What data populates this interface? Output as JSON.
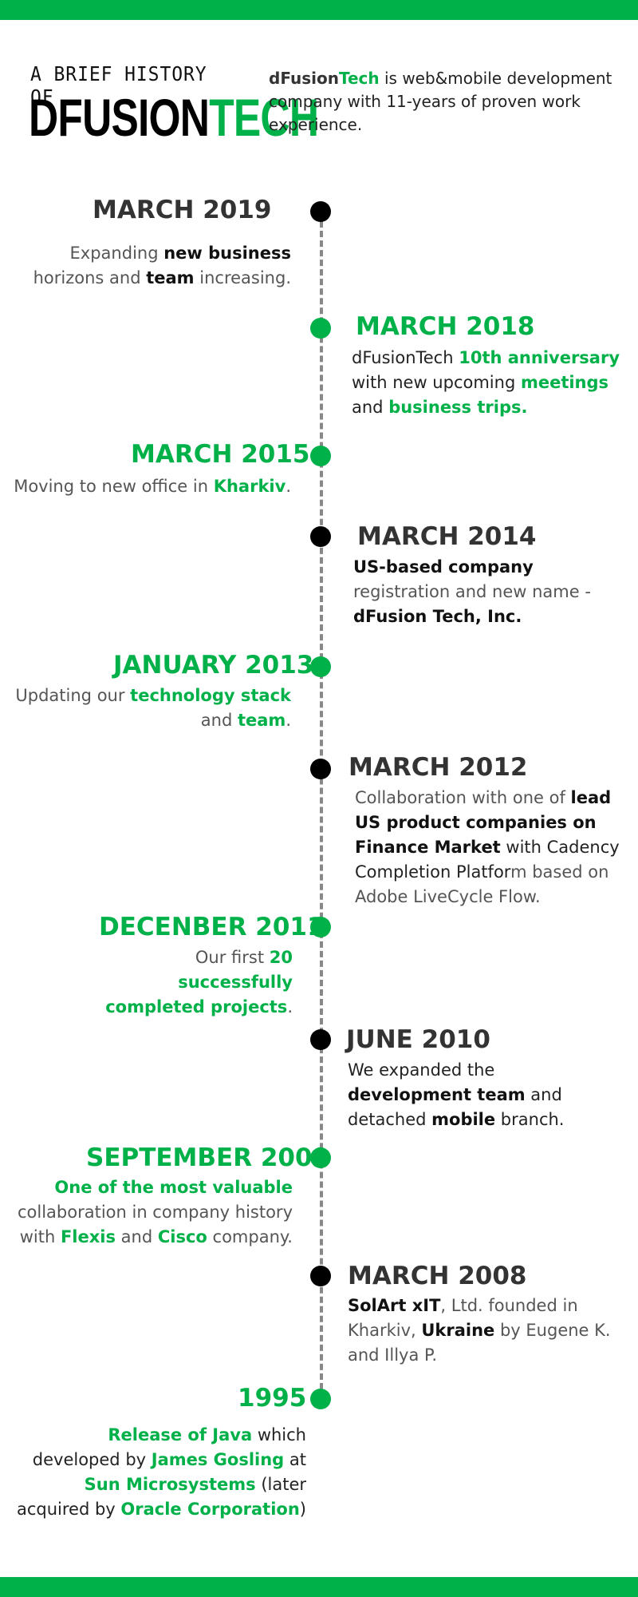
{
  "colors": {
    "accent": "#00b048",
    "dark": "#333333",
    "black": "#000000",
    "line": "#888888"
  },
  "header": {
    "pre": "A BRIEF HISTORY OF",
    "logo_part1": "DFUSION",
    "logo_part2": "TECH",
    "intro_name1": "dFusion",
    "intro_name2": "Tech",
    "intro_text": " is web&mobile development company with 11-years of proven work experience."
  },
  "events": [
    {
      "date": "MARCH 2019",
      "parts": [
        "Expanding ",
        "new business",
        " horizons and ",
        "team",
        " increasing."
      ]
    },
    {
      "date": "MARCH 2018",
      "parts": [
        "dFusionTech ",
        "10th anniversary",
        " with new upcoming ",
        "meetings",
        " and ",
        "business trips."
      ]
    },
    {
      "date": "MARCH 2015",
      "parts": [
        "Moving to new office in ",
        "Kharkiv",
        "."
      ]
    },
    {
      "date": "MARCH 2014",
      "parts": [
        "US-based company",
        " registration and new name - ",
        "dFusion Tech, Inc."
      ]
    },
    {
      "date": "JANUARY 2013",
      "parts": [
        "Updating our ",
        "technology stack",
        " and ",
        "team",
        "."
      ]
    },
    {
      "date": "MARCH 2012",
      "parts": [
        "Collaboration with one of ",
        "lead US product companies on Finance Market",
        " with Cadency Completion Platfor",
        "m based on Adobe LiveCycle Flow."
      ]
    },
    {
      "date": "DECENBER 2011",
      "parts": [
        "Our first ",
        "20 successfully completed projects",
        "."
      ]
    },
    {
      "date": "JUNE 2010",
      "parts": [
        "We expanded the ",
        "development team",
        " and detached ",
        "mobile",
        " branch."
      ]
    },
    {
      "date": "SEPTEMBER 2009",
      "parts": [
        "One of the most valuable",
        " collaboration in company history with ",
        "Flexis",
        " and ",
        "Cisco",
        " company."
      ]
    },
    {
      "date": "MARCH 2008",
      "parts": [
        "SolArt xIT",
        ", Ltd. founded in Kharkiv, ",
        "Ukraine",
        " by Eugene K. and Illya P."
      ]
    },
    {
      "date": "1995",
      "parts": [
        "Release of Java",
        " which developed by ",
        "James Gosling",
        " at ",
        "Sun Microsystems",
        " (later acquired by ",
        "Oracle Corporation",
        ")"
      ]
    }
  ]
}
